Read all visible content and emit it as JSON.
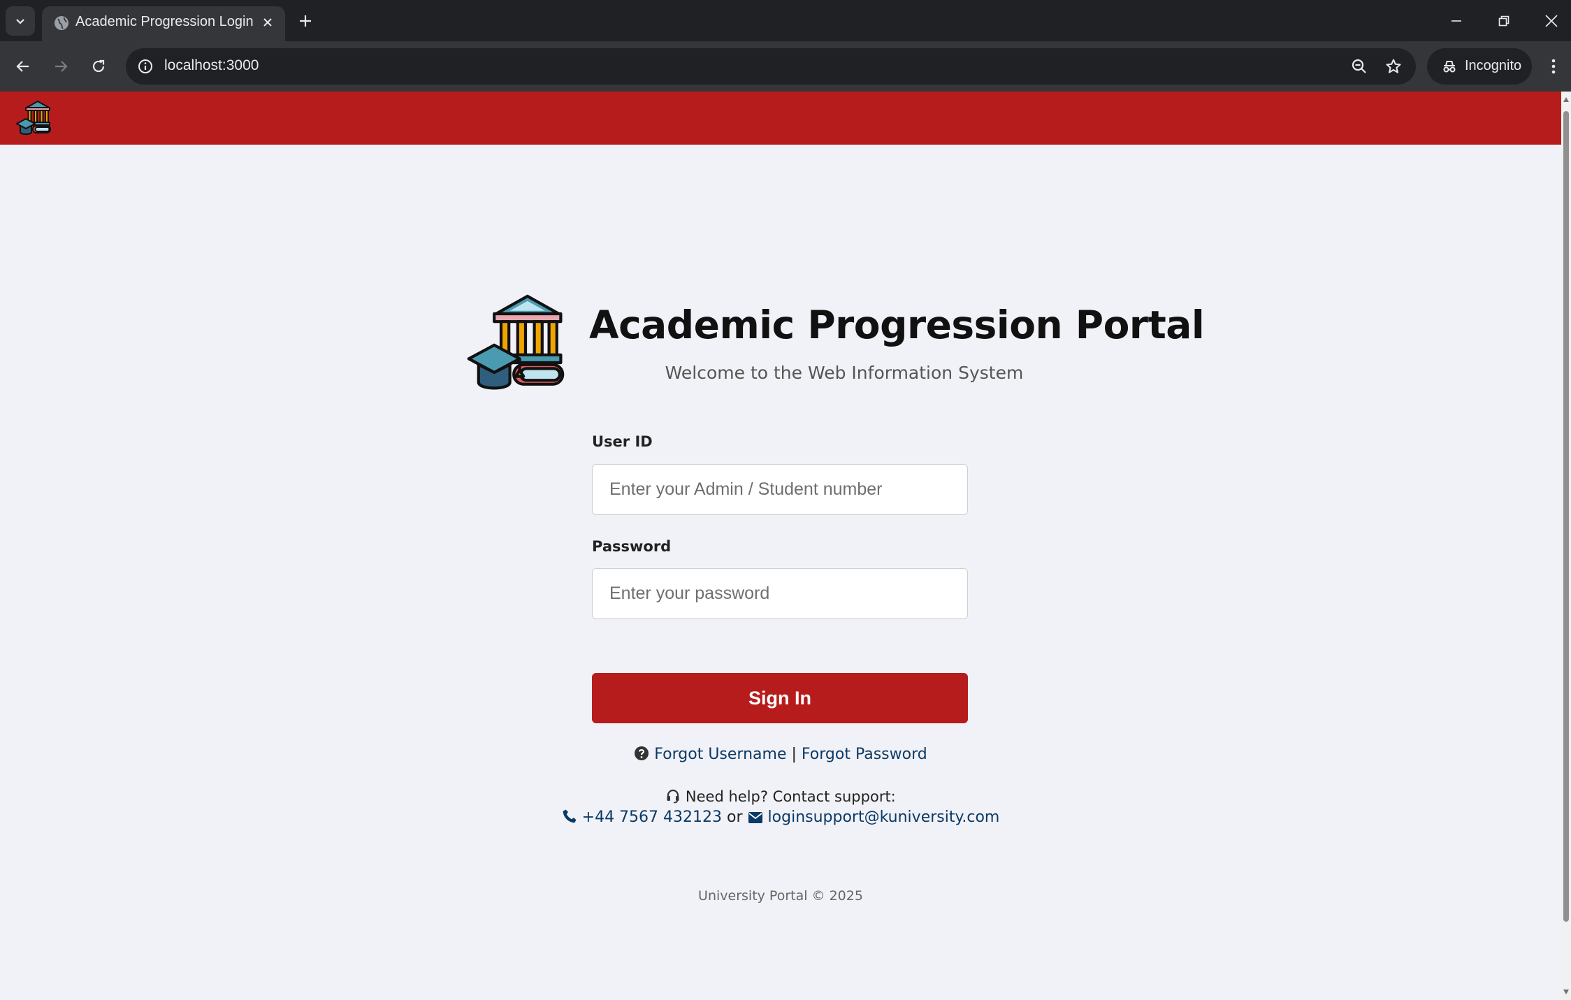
{
  "browser": {
    "tab_title": "Academic Progression Login",
    "url": "localhost:3000",
    "incognito_label": "Incognito"
  },
  "page": {
    "title": "Academic Progression Portal",
    "subtitle": "Welcome to the Web Information System",
    "form": {
      "user_id_label": "User ID",
      "user_id_placeholder": "Enter your Admin / Student number",
      "user_id_value": "",
      "password_label": "Password",
      "password_placeholder": "Enter your password",
      "password_value": "",
      "submit_label": "Sign In"
    },
    "links": {
      "forgot_username": "Forgot Username",
      "separator": "|",
      "forgot_password": "Forgot Password"
    },
    "support": {
      "help_text": "Need help? Contact support:",
      "phone": "+44 7567 432123",
      "or_text": "or",
      "email": "loginsupport@kuniversity.com"
    },
    "footer": "University Portal © 2025"
  },
  "colors": {
    "brand_red": "#b71c1c",
    "link_blue": "#0b3a66",
    "page_background": "#f1f2f7"
  },
  "icons": [
    "tab-list-icon",
    "globe-icon",
    "close-icon",
    "plus-icon",
    "minimize-icon",
    "restore-icon",
    "back-icon",
    "forward-icon",
    "reload-icon",
    "info-icon",
    "zoom-icon",
    "star-icon",
    "incognito-icon",
    "kebab-icon",
    "university-logo-icon",
    "question-circle-icon",
    "headset-icon",
    "phone-icon",
    "envelope-icon"
  ]
}
